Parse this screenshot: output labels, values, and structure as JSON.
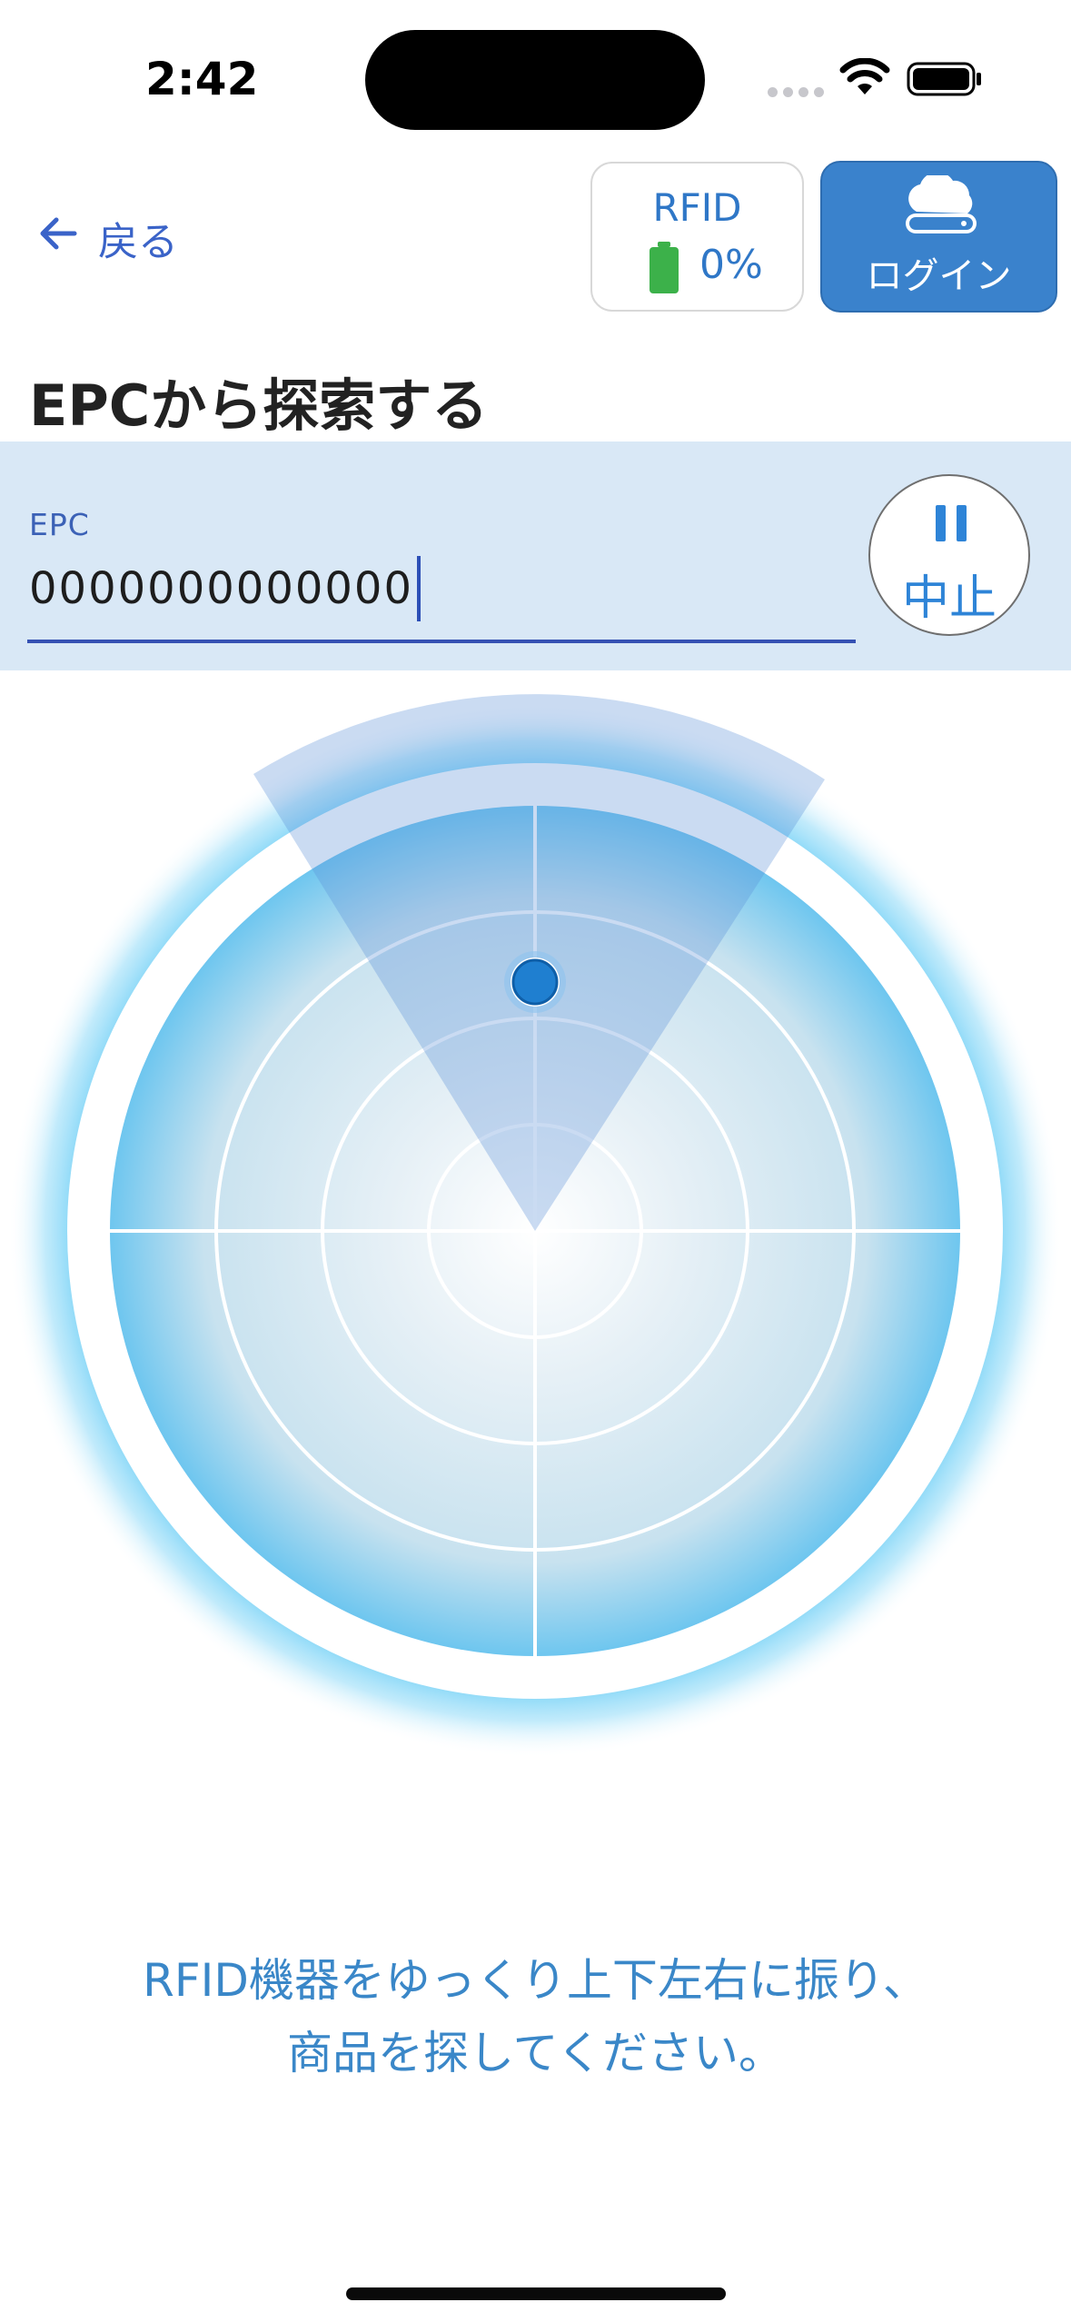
{
  "status_bar": {
    "time": "2:42"
  },
  "header": {
    "back_label": "戻る",
    "rfid_label": "RFID",
    "rfid_battery": "0%",
    "login_label": "ログイン"
  },
  "page_title": "EPCから探索する",
  "epc_field": {
    "label": "EPC",
    "value": "0000000000000"
  },
  "stop_button": {
    "label": "中止"
  },
  "instructions": {
    "line1": "RFID機器をゆっくり上下左右に振り、",
    "line2": "商品を探してください。"
  },
  "colors": {
    "accent": "#3a82cc",
    "panel_bg": "#d9e8f6",
    "battery_green": "#3cb14a",
    "text_blue": "#3a87c8"
  },
  "icons": [
    "back-arrow-icon",
    "battery-icon",
    "cloud-server-icon",
    "pause-icon",
    "wifi-icon",
    "status-battery-icon"
  ]
}
